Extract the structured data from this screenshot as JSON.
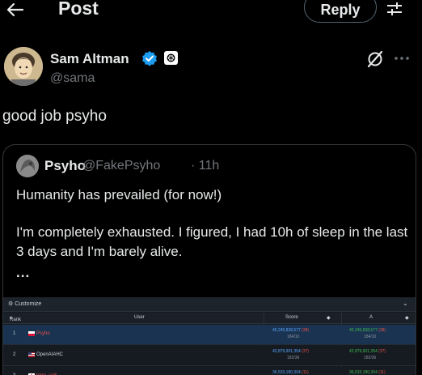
{
  "header": {
    "title": "Post",
    "reply_label": "Reply"
  },
  "author": {
    "name": "Sam Altman",
    "handle": "@sama"
  },
  "tweet": {
    "text": "good job psyho"
  },
  "quote": {
    "name": "Psyho",
    "handle": "@FakePsyho",
    "time": "· 11h",
    "line1": "Humanity has prevailed (for now!)",
    "line2": "I'm completely exhausted. I figured, I had 10h of sleep in the last 3 days and I'm barely alive.",
    "ellipsis": "..."
  },
  "leaderboard": {
    "customize": "Customize",
    "columns": {
      "rank": "Rank",
      "user": "User",
      "score": "Score",
      "a": "A"
    },
    "rows": [
      {
        "rank": "1",
        "user": "Psyho",
        "score": "45,245,838,577",
        "score_delta": "(38)",
        "score_sub": "184/10",
        "a": "45,245,838,577",
        "a_delta": "(38)",
        "a_sub": "184/10"
      },
      {
        "rank": "2",
        "user": "OpenAIAHC",
        "score": "42,879,901,354",
        "score_delta": "(37)",
        "score_sub": "182/36",
        "a": "42,879,901,354",
        "a_delta": "(37)",
        "a_sub": "182/36"
      },
      {
        "rank": "3",
        "user": "terry_u16",
        "score": "36,533,180,304",
        "score_delta": "(11)",
        "score_sub": "",
        "a": "36,533,180,304",
        "a_delta": "(11)",
        "a_sub": ""
      }
    ]
  },
  "colors": {
    "background": "#000000",
    "text_primary": "#e7e9ea",
    "text_secondary": "#71767b",
    "verified_blue": "#1d9bf0",
    "border": "#333639"
  },
  "icons": {
    "back": "arrow-left-icon",
    "filter": "sliders-icon",
    "verified": "verified-badge-icon",
    "affiliate": "openai-logo-icon",
    "grok": "grok-icon",
    "more": "more-horizontal-icon"
  }
}
